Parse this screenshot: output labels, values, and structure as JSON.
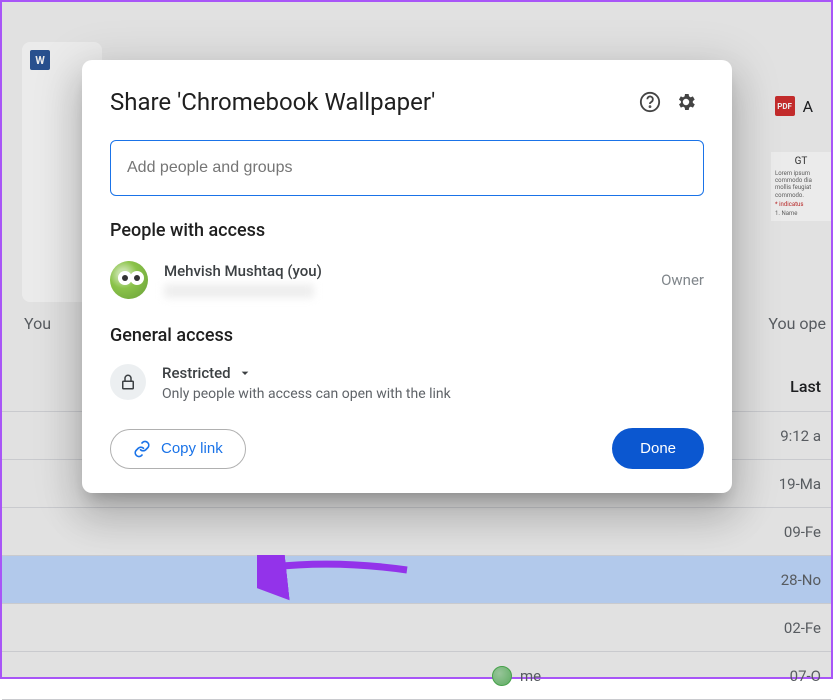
{
  "background": {
    "word_icon": "W",
    "pdf_icon": "PDF",
    "pdf_label": "A",
    "doc_title": "GT",
    "you_label": "You",
    "you_opened": "You ope",
    "column_header": "Last",
    "rows": [
      {
        "date": "9:12 a"
      },
      {
        "date": "19-Ma"
      },
      {
        "date": "09-Fe"
      },
      {
        "date": "28-No",
        "selected": true
      },
      {
        "date": "02-Fe"
      },
      {
        "owner": "me",
        "date": "07-O"
      }
    ]
  },
  "modal": {
    "title": "Share 'Chromebook Wallpaper'",
    "input_placeholder": "Add people and groups",
    "people_title": "People with access",
    "person": {
      "name": "Mehvish Mushtaq (you)",
      "role": "Owner"
    },
    "general_title": "General access",
    "access": {
      "label": "Restricted",
      "description": "Only people with access can open with the link"
    },
    "copy_link": "Copy link",
    "done": "Done"
  }
}
